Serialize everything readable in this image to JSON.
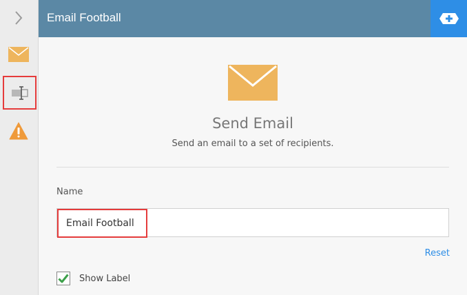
{
  "header": {
    "title": "Email Football"
  },
  "sidebar": {
    "items": [
      {
        "icon": "chevron-right-icon"
      },
      {
        "icon": "envelope-icon"
      },
      {
        "icon": "text-field-icon",
        "selected": true
      },
      {
        "icon": "warning-icon"
      }
    ]
  },
  "hero": {
    "icon": "envelope-icon",
    "title": "Send Email",
    "description": "Send an email to a set of recipients."
  },
  "form": {
    "name_label": "Name",
    "name_value": "Email Football",
    "reset_label": "Reset",
    "show_label": {
      "label": "Show Label",
      "checked": true
    }
  },
  "colors": {
    "header_bg": "#5b88a5",
    "accent": "#2e8ee6",
    "envelope": "#eeb55d",
    "warning": "#ef9a3a",
    "check": "#3ca04a",
    "highlight": "#e53b3b"
  }
}
